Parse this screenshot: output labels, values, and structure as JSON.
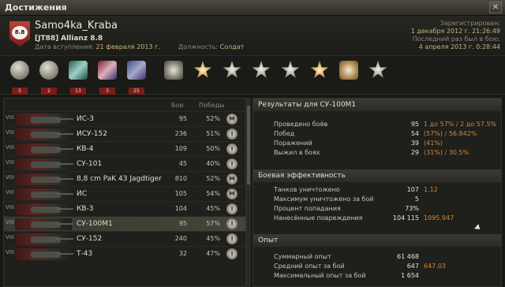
{
  "window": {
    "title": "Достижения",
    "close_label": "✕"
  },
  "player": {
    "emblem_text": "8.8",
    "name": "Samo4ka_Kraba",
    "clan_tag": "[JT88]",
    "clan_name": "Allianz 8.8",
    "joined_label": "Дата вступления:",
    "joined_value": "21 февраля 2013 г.",
    "position_label": "Должность:",
    "position_value": "Солдат",
    "registered_label": "Зарегистрирован:",
    "registered_value": "1 декабря 2012 г. 21:26:49",
    "lastbattle_label": "Последний раз был в бою:",
    "lastbattle_value": "4 апреля 2013 г. 0:28:44"
  },
  "medals": [
    {
      "icon": "class-badge-icon",
      "count": "5"
    },
    {
      "icon": "class-badge-icon",
      "count": "2"
    },
    {
      "icon": "warrior-icon",
      "count": "13"
    },
    {
      "icon": "sniper-icon",
      "count": "3"
    },
    {
      "icon": "defender-icon",
      "count": "25"
    },
    {
      "icon": "shield-medal-icon",
      "count": ""
    },
    {
      "icon": "gold-star-medal-icon",
      "count": ""
    },
    {
      "icon": "star-medal-icon",
      "count": ""
    },
    {
      "icon": "star-medal-icon",
      "count": ""
    },
    {
      "icon": "star-medal-icon",
      "count": ""
    },
    {
      "icon": "gold-star-medal-icon",
      "count": ""
    },
    {
      "icon": "diamond-medal-icon",
      "count": ""
    },
    {
      "icon": "star-medal-icon",
      "count": ""
    }
  ],
  "tank_list": {
    "col_battles": "Бои",
    "col_wins": "Победы",
    "rows": [
      {
        "tier": "VIII",
        "name": "ИС-3",
        "battles": "95",
        "wins": "52%",
        "mark": "M"
      },
      {
        "tier": "VIII",
        "name": "ИСУ-152",
        "battles": "236",
        "wins": "51%",
        "mark": "I"
      },
      {
        "tier": "VIII",
        "name": "КВ-4",
        "battles": "109",
        "wins": "50%",
        "mark": "I"
      },
      {
        "tier": "VIII",
        "name": "СУ-101",
        "battles": "45",
        "wins": "40%",
        "mark": "I"
      },
      {
        "tier": "VIII",
        "name": "8,8 cm PaK 43 Jagdtiger",
        "battles": "810",
        "wins": "52%",
        "mark": "M"
      },
      {
        "tier": "VIII",
        "name": "ИС",
        "battles": "105",
        "wins": "54%",
        "mark": "M"
      },
      {
        "tier": "VIII",
        "name": "КВ-3",
        "battles": "104",
        "wins": "45%",
        "mark": "I"
      },
      {
        "tier": "VIII",
        "name": "СУ-100М1",
        "battles": "95",
        "wins": "57%",
        "mark": "I"
      },
      {
        "tier": "VIII",
        "name": "СУ-152",
        "battles": "240",
        "wins": "45%",
        "mark": "I"
      },
      {
        "tier": "VIII",
        "name": "Т-43",
        "battles": "32",
        "wins": "47%",
        "mark": "I"
      }
    ]
  },
  "results": {
    "title": "Результаты для СУ-100М1",
    "rows": [
      {
        "label": "Проведено боёв",
        "value": "95",
        "ext": "1 до 57% / 2 до 57.5%"
      },
      {
        "label": "Побед",
        "value": "54",
        "ext_a": "(57%)",
        "ext_sep": " / ",
        "ext_b": "56.842%"
      },
      {
        "label": "Поражений",
        "value": "39",
        "ext_a": "(41%)",
        "ext_sep": "",
        "ext_b": ""
      },
      {
        "label": "Выжил в боях",
        "value": "29",
        "ext_a": "(31%)",
        "ext_sep": " / ",
        "ext_b": "30.5%"
      }
    ]
  },
  "efficiency": {
    "title": "Боевая эффективность",
    "rows": [
      {
        "label": "Танков уничтожено",
        "value": "107",
        "ext": "1.12"
      },
      {
        "label": "Максимум уничтожено за бой",
        "value": "5",
        "ext": ""
      },
      {
        "label": "Процент попадания",
        "value": "73%",
        "ext": ""
      },
      {
        "label": "Нанесённые повреждения",
        "value": "104 115",
        "ext": "1095.947"
      }
    ]
  },
  "experience": {
    "title": "Опыт",
    "rows": [
      {
        "label": "Суммарный опыт",
        "value": "61 468",
        "ext": ""
      },
      {
        "label": "Средний опыт за бой",
        "value": "647",
        "ext": "647.03"
      },
      {
        "label": "Максимальный опыт за бой",
        "value": "1 654",
        "ext": ""
      }
    ]
  }
}
